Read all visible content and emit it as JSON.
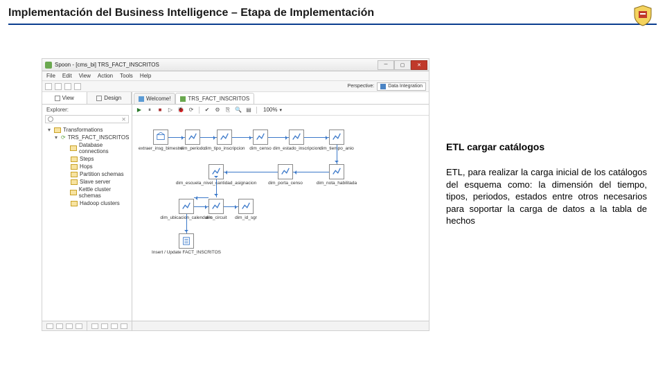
{
  "header": {
    "title": "Implementación del Business Intelligence – Etapa de Implementación"
  },
  "description": {
    "title": "ETL cargar catálogos",
    "body": "ETL, para realizar la carga inicial de los catálogos del esquema como: la dimensión del tiempo, tipos, periodos, estados entre otros necesarios para soportar la carga de datos a la tabla de hechos"
  },
  "window": {
    "title": "Spoon - [cms_bi] TRS_FACT_INSCRITOS",
    "menu": [
      "File",
      "Edit",
      "View",
      "Action",
      "Tools",
      "Help"
    ],
    "perspective_label": "Perspective:",
    "perspective_value": "Data Integration",
    "left_tabs": {
      "view": "View",
      "design": "Design"
    },
    "explorer_label": "Explorer:",
    "tree": {
      "root": "Transformations",
      "main": "TRS_FACT_INSCRITOS",
      "children": [
        "Database connections",
        "Steps",
        "Hops",
        "Partition schemas",
        "Slave server",
        "Kettle cluster schemas",
        "Hadoop clusters"
      ]
    },
    "tabs": {
      "welcome": "Welcome!",
      "active": "TRS_FACT_INSCRITOS"
    },
    "zoom": "100%",
    "row1": [
      "extraer_insg_bimestre",
      "dim_periodo",
      "dim_tipo_inscripcion",
      "dim_censo",
      "dim_estado_inscripcion",
      "dim_tiempo_anio"
    ],
    "row2": [
      "dim_escuela_nivel_cantidad_asignacion",
      "dim_porta_censo",
      "dim_nota_habilitada"
    ],
    "row3": [
      "dim_ubicacion_calendario",
      "dim_circuit",
      "dim_id_sgr"
    ],
    "final_node": "Insert / Update FACT_INSCRITOS"
  }
}
